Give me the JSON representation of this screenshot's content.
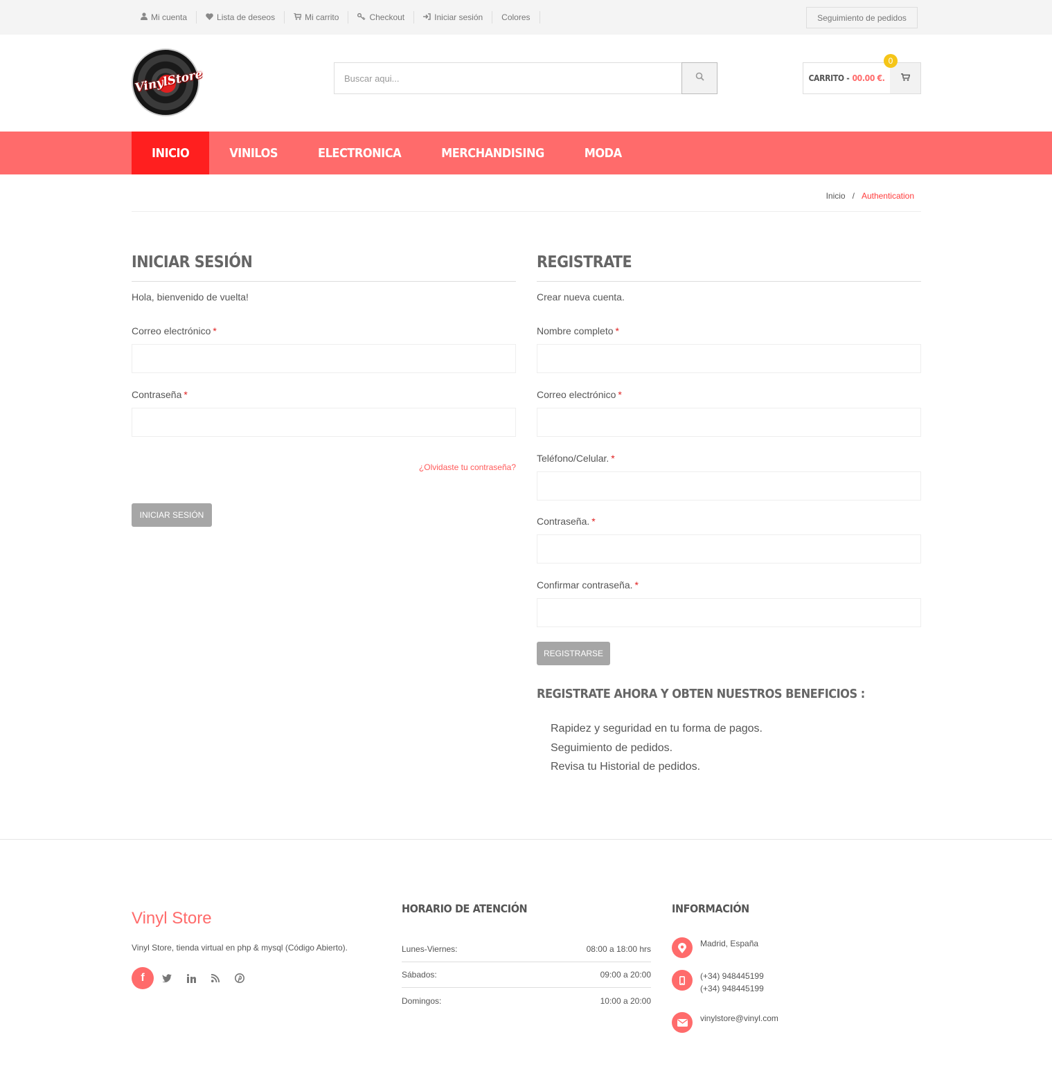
{
  "topbar": {
    "links": [
      {
        "icon": "user-icon",
        "label": "Mi cuenta"
      },
      {
        "icon": "heart-icon",
        "label": "Lista de deseos"
      },
      {
        "icon": "cart-icon",
        "label": "Mi carrito"
      },
      {
        "icon": "key-icon",
        "label": "Checkout"
      },
      {
        "icon": "sign-in-icon",
        "label": "Iniciar sesión"
      },
      {
        "icon": "",
        "label": "Colores"
      }
    ],
    "track_orders": "Seguimiento de pedidos"
  },
  "header": {
    "logo_text": "VinylStore",
    "search_placeholder": "Buscar aqui...",
    "cart_label": "CARRITO -",
    "cart_amount": "00.00 €.",
    "cart_count": "0"
  },
  "nav": {
    "items": [
      "INICIO",
      "VINILOS",
      "ELECTRONICA",
      "MERCHANDISING",
      "MODA"
    ],
    "active": "INICIO"
  },
  "breadcrumb": {
    "home": "Inicio",
    "separator": "/",
    "current": "Authentication"
  },
  "login": {
    "title": "INICIAR SESIÓN",
    "intro": "Hola, bienvenido de vuelta!",
    "email_label": "Correo electrónico",
    "password_label": "Contraseña",
    "required_mark": "*",
    "forgot": "¿Olvidaste tu contraseña?",
    "submit": "INICIAR SESIÓN"
  },
  "register": {
    "title": "REGISTRATE",
    "intro": "Crear nueva cuenta.",
    "name_label": "Nombre completo",
    "email_label": "Correo electrónico",
    "phone_label": "Teléfono/Celular.",
    "password_label": "Contraseña.",
    "confirm_label": "Confirmar contraseña.",
    "required_mark": "*",
    "submit": "REGISTRARSE",
    "benefits_title": "REGISTRATE AHORA Y OBTEN NUESTROS BENEFICIOS :",
    "benefits": [
      "Rapidez y seguridad en tu forma de pagos.",
      "Seguimiento de pedidos.",
      "Revisa tu Historial de pedidos."
    ]
  },
  "footer": {
    "brand": "Vinyl Store",
    "description": "Vinyl Store, tienda virtual en php & mysql (Código Abierto).",
    "social": [
      "facebook-icon",
      "twitter-icon",
      "linkedin-icon",
      "rss-icon",
      "pinterest-icon"
    ],
    "hours_title": "HORARIO DE ATENCIÓN",
    "hours": [
      {
        "day": "Lunes-Viernes:",
        "time": "08:00 a 18:00 hrs"
      },
      {
        "day": "Sábados:",
        "time": "09:00 a 20:00"
      },
      {
        "day": "Domingos:",
        "time": "10:00 a 20:00"
      }
    ],
    "info_title": "INFORMACIÓN",
    "address": "Madrid, España",
    "phone1": "(+34) 948445199",
    "phone2": "(+34) 948445199",
    "email": "vinylstore@vinyl.com"
  },
  "colors": {
    "accent": "#ff6b6b",
    "nav_active": "#ff1f1f",
    "badge": "#f5c518",
    "button": "#a6a6a6"
  }
}
